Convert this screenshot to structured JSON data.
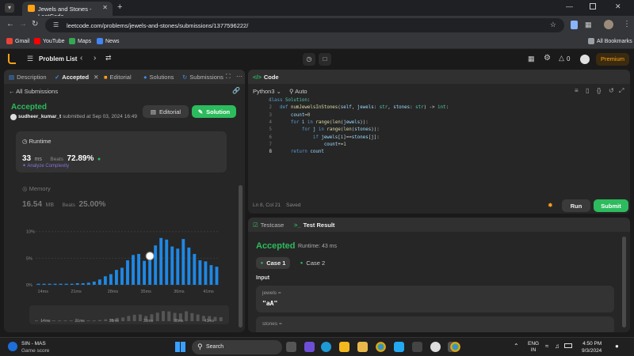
{
  "browser": {
    "tab_title": "Jewels and Stones - LeetCode",
    "url": "leetcode.com/problems/jewels-and-stones/submissions/1377596222/",
    "bookmarks": [
      "Gmail",
      "YouTube",
      "Maps",
      "News"
    ],
    "all_bookmarks": "All Bookmarks"
  },
  "topbar": {
    "problem_list": "Problem List",
    "streak_count": "0",
    "premium": "Premium"
  },
  "left_panel": {
    "tabs": [
      "Description",
      "Accepted",
      "Editorial",
      "Solutions",
      "Submissions"
    ],
    "all_submissions": "All Submissions",
    "status": "Accepted",
    "user": "sudheer_kumar_t",
    "submitted_text": "submitted at Sep 03, 2024 16:49",
    "editorial_btn": "Editorial",
    "solution_btn": "Solution",
    "runtime_label": "Runtime",
    "runtime_value": "33",
    "runtime_unit": "ms",
    "beats_label": "Beats",
    "runtime_beats": "72.89%",
    "analyze": "Analyze Complexity",
    "memory_label": "Memory",
    "memory_value": "16.54",
    "memory_unit": "MB",
    "memory_beats": "25.00%",
    "chart_y_ticks": [
      "10%",
      "5%",
      "0%"
    ],
    "chart_x_ticks": [
      "14ms",
      "21ms",
      "28ms",
      "35ms",
      "36ms",
      "41ms"
    ],
    "mini_x_ticks": [
      "14ms",
      "21ms",
      "28ms",
      "31ms",
      "38ms",
      "41ms"
    ]
  },
  "chart_data": {
    "type": "bar",
    "title": "",
    "xlabel": "",
    "ylabel": "",
    "ylim": [
      0,
      11
    ],
    "x_tick_labels": [
      "14ms",
      "21ms",
      "28ms",
      "35ms",
      "36ms",
      "41ms"
    ],
    "values": [
      0.2,
      0.2,
      0.2,
      0.2,
      0.2,
      0.2,
      0.2,
      0.3,
      0.3,
      0.4,
      0.6,
      1.0,
      1.6,
      2.0,
      2.8,
      3.2,
      4.6,
      5.6,
      5.8,
      4.5,
      6.0,
      7.4,
      8.8,
      8.5,
      7.2,
      6.8,
      8.6,
      7.0,
      5.8,
      4.6,
      4.4,
      3.7,
      3.4
    ],
    "highlight_index": 20,
    "highlight_color": "#ffffff",
    "bar_color": "#1e88e5"
  },
  "editor": {
    "title": "Code",
    "language": "Python3",
    "mode": "Auto",
    "lines": [
      "class Solution:",
      "    def numJewelsInStones(self, jewels: str, stones: str) -> int:",
      "        count=0",
      "        for i in range(len(jewels)):",
      "            for j in range(len(stones)):",
      "                if jewels[i]==stones[j]:",
      "                    count+=1",
      "        return count"
    ],
    "line_numbers": [
      "1",
      "2",
      "3",
      "4",
      "5",
      "6",
      "7",
      "8"
    ],
    "status_pos": "Ln 8, Col 21",
    "status_saved": "Saved",
    "run": "Run",
    "submit": "Submit"
  },
  "testpanel": {
    "tab_testcase": "Testcase",
    "tab_result": "Test Result",
    "status": "Accepted",
    "runtime": "Runtime: 43 ms",
    "case1": "Case 1",
    "case2": "Case 2",
    "input_label": "Input",
    "jewels_label": "jewels =",
    "jewels_value": "\"aA\"",
    "stones_label": "stones ="
  },
  "taskbar": {
    "weather_title": "SIN - MAS",
    "weather_sub": "Game score",
    "search": "Search",
    "lang1": "ENG",
    "lang2": "IN",
    "time": "4:50 PM",
    "date": "9/3/2024"
  },
  "colors": {
    "accent_green": "#2cbb5d",
    "accepted_green": "#2cbb5d",
    "premium_orange": "#ffa116",
    "bar_blue": "#1e88e5"
  }
}
